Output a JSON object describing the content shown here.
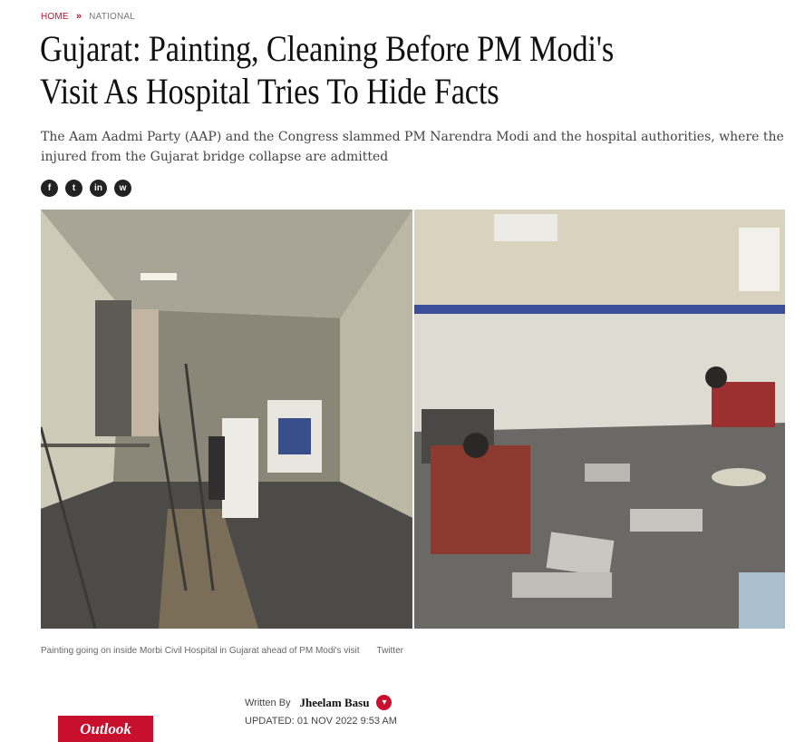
{
  "breadcrumb": {
    "home": "HOME",
    "separator": "»",
    "section": "NATIONAL"
  },
  "article": {
    "title": "Gujarat: Painting, Cleaning Before PM Modi's Visit As Hospital Tries To Hide Facts",
    "dek": "The Aam Aadmi Party (AAP) and the Congress slammed PM Narendra Modi and the hospital authorities, where the injured from the Gujarat bridge collapse are admitted",
    "caption": "Painting going on inside Morbi Civil Hospital in Gujarat ahead of PM Modi's visit",
    "credit": "Twitter"
  },
  "share": {
    "icons": [
      "facebook-icon",
      "twitter-icon",
      "linkedin-icon",
      "whatsapp-icon"
    ],
    "glyphs": [
      "f",
      "t",
      "in",
      "w"
    ]
  },
  "byline": {
    "label": "Written By",
    "author": "Jheelam Basu",
    "updated": "UPDATED: 01 NOV 2022 9:53 AM"
  },
  "brand": {
    "logo_text": "Outlook",
    "color": "#c8102e"
  }
}
